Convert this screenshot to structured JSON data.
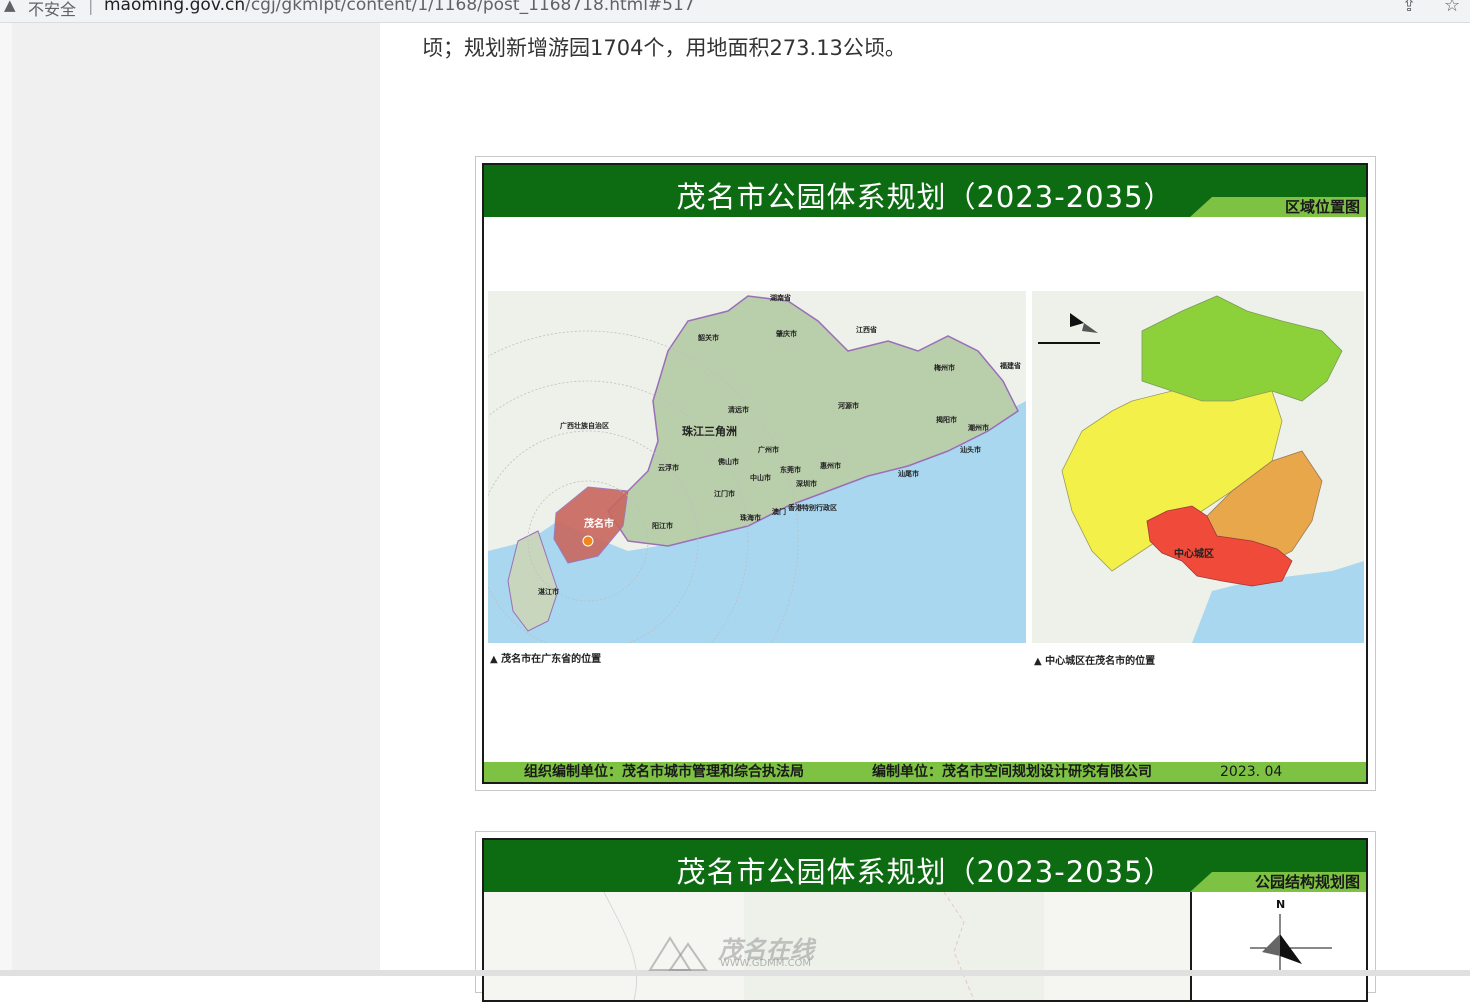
{
  "browser": {
    "security_label": "不安全",
    "separator": "|",
    "url_domain": "maoming.gov.cn",
    "url_path": "/cgj/gkmlpt/content/1/1168/post_1168718.html#517"
  },
  "article": {
    "paragraph_tail": "顷；规划新增游园1704个，用地面积273.13公顷。"
  },
  "plates": [
    {
      "title": "茂名市公园体系规划（2023-2035）",
      "subtitle": "区域位置图",
      "left_map": {
        "caption": "▲ 茂名市在广东省的位置",
        "labels": {
          "maoming": "茂名市",
          "prd": "珠江三角洲",
          "hunan": "湖南省",
          "jiangxi": "江西省",
          "fujian": "福建省",
          "guangxi": "广西壮族自治区",
          "zhanjiang": "湛江市",
          "yangjiang": "阳江市",
          "shaoguan": "韶关市",
          "qingyuan": "清远市",
          "guangzhou": "广州市",
          "foshan": "佛山市",
          "zhaoqing": "肇庆市",
          "jiangmen": "江门市",
          "zhongshan": "中山市",
          "zhuhai": "珠海市",
          "macau": "澳门",
          "hongkong": "香港特别行政区",
          "shenzhen": "深圳市",
          "dongguan": "东莞市",
          "huizhou": "惠州市",
          "heyuan": "河源市",
          "shanwei": "汕尾市",
          "meizhou": "梅州市",
          "chaozhou": "潮州市",
          "shantou": "汕头市",
          "jieyang": "揭阳市",
          "yunfu": "云浮市"
        }
      },
      "right_map": {
        "caption": "▲ 中心城区在茂名市的位置",
        "center_label": "中心城区"
      },
      "footer": {
        "organizer": "组织编制单位：茂名市城市管理和综合执法局",
        "compiler": "编制单位：茂名市空间规划设计研究有限公司",
        "date": "2023. 04"
      }
    },
    {
      "title": "茂名市公园体系规划（2023-2035）",
      "subtitle": "公园结构规划图",
      "north_label": "N"
    }
  ],
  "watermark": {
    "brand": "茂名在线",
    "url": "WWW.GDMM.COM"
  },
  "colors": {
    "header_green": "#0d6b12",
    "accent_green": "#7dc242",
    "maoming_red": "#c9665e",
    "center_red": "#f04a3a",
    "sea_blue": "#a8d7ef"
  }
}
